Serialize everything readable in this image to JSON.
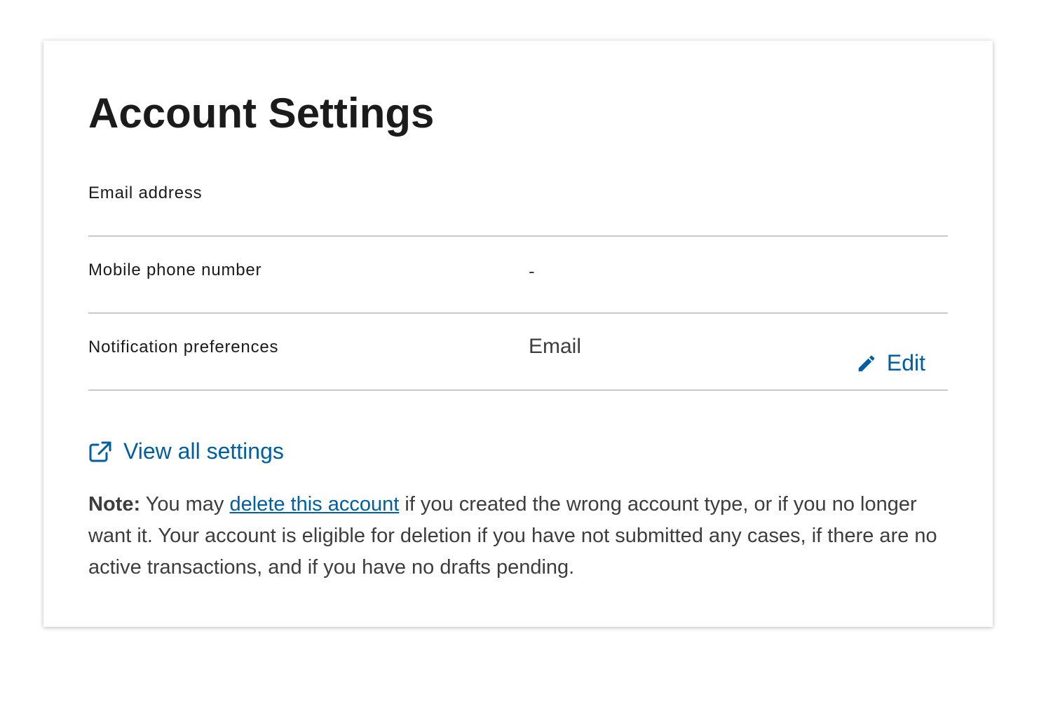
{
  "page": {
    "title": "Account Settings"
  },
  "settings_rows": [
    {
      "label": "Email address",
      "value": ""
    },
    {
      "label": "Mobile phone number",
      "value": "-"
    },
    {
      "label": "Notification preferences",
      "value": "Email"
    }
  ],
  "actions": {
    "edit_label": "Edit",
    "edit_icon": "pencil-icon",
    "view_all_label": "View all settings",
    "view_all_icon": "external-link-icon"
  },
  "note": {
    "prefix": "Note:",
    "before_link": " You may ",
    "link_text": "delete this account",
    "after_link": " if you created the wrong account type, or if you no longer want it. Your account is eligible for deletion if you have not submitted any cases, if there are no active transactions, and if you have no drafts pending."
  },
  "colors": {
    "link": "#005ea2",
    "text": "#1b1b1b",
    "muted_text": "#3d3d3d",
    "divider": "#c9c9c9"
  }
}
